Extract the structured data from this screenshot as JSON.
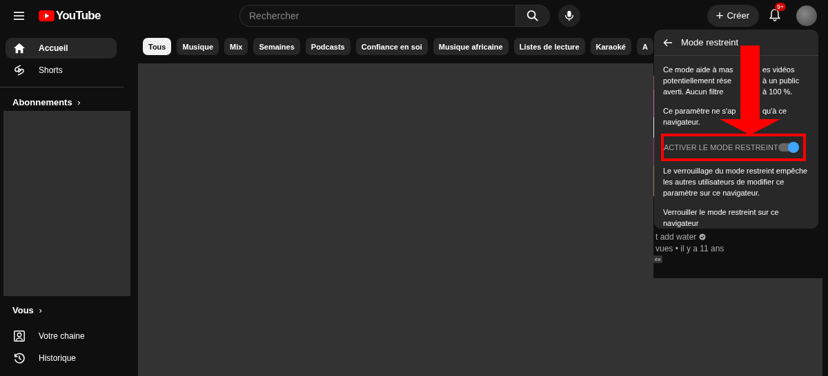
{
  "header": {
    "logo": "YouTube",
    "search": {
      "placeholder": "Rechercher"
    },
    "create_icon": "+",
    "create_button": "Créer",
    "notifications_badge": "9+"
  },
  "sidebar": {
    "items": [
      {
        "label": "Accueil",
        "selected": true,
        "kind": "home"
      },
      {
        "label": "Shorts",
        "selected": false,
        "kind": "shorts"
      }
    ],
    "subscriptions_heading": "Abonnements",
    "subscriptions_chevron": "›",
    "you_heading": "Vous",
    "you_chevron": "›",
    "you_items": [
      {
        "label": "Votre chaine",
        "kind": "channel"
      },
      {
        "label": "Historique",
        "kind": "history"
      }
    ]
  },
  "chips": [
    {
      "label": "Tous",
      "selected": true
    },
    {
      "label": "Musique",
      "selected": false
    },
    {
      "label": "Mix",
      "selected": false
    },
    {
      "label": "Semaines",
      "selected": false
    },
    {
      "label": "Podcasts",
      "selected": false
    },
    {
      "label": "Confiance en soi",
      "selected": false
    },
    {
      "label": "Musique africaine",
      "selected": false
    },
    {
      "label": "Listes de lecture",
      "selected": false
    },
    {
      "label": "Karaoké",
      "selected": false
    },
    {
      "label": "A",
      "selected": false
    }
  ],
  "video": {
    "channel": "t add water",
    "verified": true,
    "meta": "vues • il y a 11 ans",
    "badge": "ée"
  },
  "popup": {
    "title": "Mode restreint",
    "paragraphs": [
      [
        {
          "left": "Ce mode aide à mas",
          "right": "es vidéos"
        },
        {
          "left": "potentiellement rése",
          "right": "à un public"
        },
        {
          "left": "averti. Aucun filtre",
          "right": "à 100 %."
        }
      ],
      [
        {
          "left": "Ce paramètre ne s'ap",
          "right": "qu'à ce"
        },
        {
          "left": "navigateur."
        }
      ]
    ],
    "toggle": {
      "label": "ACTIVER LE MODE RESTREINT",
      "on": true
    },
    "lock_description": "Le verrouillage du mode restreint empêche les autres utilisateurs de modifier ce paramètre sur ce navigateur.",
    "lock_link": "Verrouiller le mode restreint sur ce navigateur"
  }
}
